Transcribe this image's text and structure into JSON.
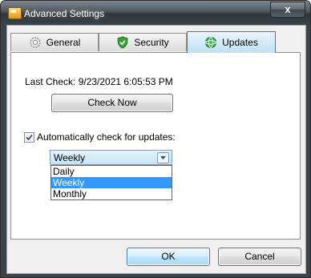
{
  "window": {
    "title": "Advanced Settings",
    "close_label": "x"
  },
  "tabs": [
    {
      "label": "General",
      "icon": "gear-icon",
      "active": false
    },
    {
      "label": "Security",
      "icon": "shield-icon",
      "active": false
    },
    {
      "label": "Updates",
      "icon": "globe-icon",
      "active": true
    }
  ],
  "updates": {
    "last_check": "Last Check: 9/23/2021 6:05:53 PM",
    "check_now_label": "Check Now",
    "auto_check_label": "Automatically check for updates:",
    "auto_check_checked": true,
    "frequency_selected": "Weekly",
    "frequency_options": [
      "Daily",
      "Weekly",
      "Monthly"
    ],
    "frequency_highlighted": "Weekly"
  },
  "footer": {
    "ok_label": "OK",
    "cancel_label": "Cancel"
  },
  "colors": {
    "selection": "#3399ff",
    "active_tab": "#bfe0f5"
  }
}
